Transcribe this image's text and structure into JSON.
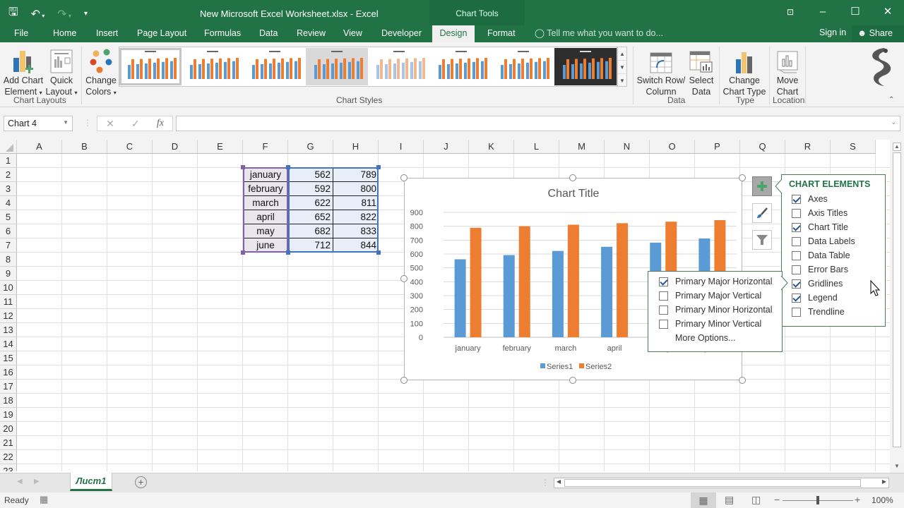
{
  "window": {
    "title": "New Microsoft Excel Worksheet.xlsx - Excel",
    "context_tab_group": "Chart Tools",
    "controls": [
      "restore-ribbon-icon",
      "minimize-icon",
      "maximize-icon",
      "close-icon"
    ]
  },
  "quick_access": {
    "save": "save-icon",
    "undo": "undo-icon",
    "redo": "redo-icon",
    "customize": "customize-icon"
  },
  "tabs": [
    "File",
    "Home",
    "Insert",
    "Page Layout",
    "Formulas",
    "Data",
    "Review",
    "View",
    "Developer",
    "Design",
    "Format"
  ],
  "active_tab": "Design",
  "tell_me": "Tell me what you want to do...",
  "sign_in": "Sign in",
  "share": "Share",
  "ribbon": {
    "add_chart_element": [
      "Add Chart",
      "Element"
    ],
    "quick_layout": [
      "Quick",
      "Layout"
    ],
    "group_chart_layouts": "Chart Layouts",
    "change_colors": [
      "Change",
      "Colors"
    ],
    "group_chart_styles": "Chart Styles",
    "switch_row_column": [
      "Switch Row/",
      "Column"
    ],
    "select_data": [
      "Select",
      "Data"
    ],
    "group_data": "Data",
    "change_chart_type": [
      "Change",
      "Chart Type"
    ],
    "group_type": "Type",
    "move_chart": [
      "Move",
      "Chart"
    ],
    "group_location": "Location",
    "styles_count": 8,
    "selected_style": 1
  },
  "formula_bar": {
    "name_box": "Chart 4",
    "formula": "",
    "fx": "fx"
  },
  "columns": [
    "A",
    "B",
    "C",
    "D",
    "E",
    "F",
    "G",
    "H",
    "I",
    "J",
    "K",
    "L",
    "M",
    "N",
    "O",
    "P",
    "Q",
    "R",
    "S"
  ],
  "rows": [
    "1",
    "2",
    "3",
    "4",
    "5",
    "6",
    "7",
    "8",
    "9",
    "10",
    "11",
    "12",
    "13",
    "14",
    "15",
    "16",
    "17",
    "18",
    "19",
    "20",
    "21",
    "22",
    "23"
  ],
  "table": [
    {
      "month": "january",
      "s1": "562",
      "s2": "789"
    },
    {
      "month": "february",
      "s1": "592",
      "s2": "800"
    },
    {
      "month": "march",
      "s1": "622",
      "s2": "811"
    },
    {
      "month": "april",
      "s1": "652",
      "s2": "822"
    },
    {
      "month": "may",
      "s1": "682",
      "s2": "833"
    },
    {
      "month": "june",
      "s1": "712",
      "s2": "844"
    }
  ],
  "chart_data": {
    "type": "bar",
    "title": "Chart Title",
    "categories": [
      "january",
      "february",
      "march",
      "april",
      "may",
      "june"
    ],
    "series": [
      {
        "name": "Series1",
        "values": [
          562,
          592,
          622,
          652,
          682,
          712
        ],
        "color": "#5b9bd5"
      },
      {
        "name": "Series2",
        "values": [
          789,
          800,
          811,
          822,
          833,
          844
        ],
        "color": "#ed7d31"
      }
    ],
    "ylim": [
      0,
      900
    ],
    "yticks": [
      "0",
      "100",
      "200",
      "300",
      "400",
      "500",
      "600",
      "700",
      "800",
      "900"
    ],
    "grid": true,
    "legend": "bottom",
    "xlabel": "",
    "ylabel": ""
  },
  "chart_elements": {
    "title": "CHART ELEMENTS",
    "items": [
      {
        "label": "Axes",
        "checked": true
      },
      {
        "label": "Axis Titles",
        "checked": false
      },
      {
        "label": "Chart Title",
        "checked": true
      },
      {
        "label": "Data Labels",
        "checked": false
      },
      {
        "label": "Data Table",
        "checked": false
      },
      {
        "label": "Error Bars",
        "checked": false
      },
      {
        "label": "Gridlines",
        "checked": true
      },
      {
        "label": "Legend",
        "checked": true
      },
      {
        "label": "Trendline",
        "checked": false
      }
    ]
  },
  "gridlines_menu": {
    "items": [
      {
        "label": "Primary Major Horizontal",
        "checked": true
      },
      {
        "label": "Primary Major Vertical",
        "checked": false
      },
      {
        "label": "Primary Minor Horizontal",
        "checked": false
      },
      {
        "label": "Primary Minor Vertical",
        "checked": false
      }
    ],
    "more": "More Options..."
  },
  "sheet_tabs": [
    "Лист1"
  ],
  "status": {
    "ready": "Ready",
    "zoom": "100%",
    "zoom_fraction": 0.5
  }
}
